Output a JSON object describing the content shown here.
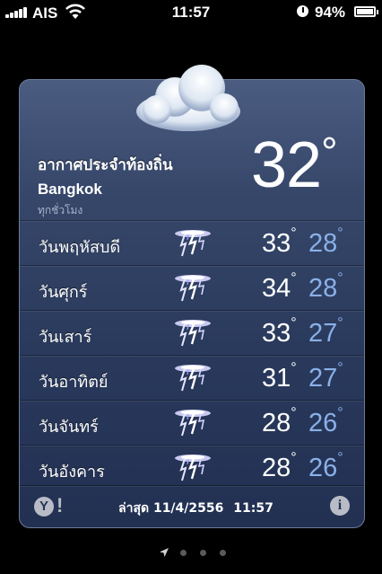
{
  "status_bar": {
    "carrier": "AIS",
    "time": "11:57",
    "battery_percent": "94%",
    "battery_level": 0.94,
    "icons": [
      "signal-icon",
      "wifi-icon",
      "alarm-icon",
      "battery-icon"
    ]
  },
  "weather": {
    "region": "อากาศประจำท้องถิ่น",
    "city": "Bangkok",
    "update_frequency": "ทุกชั่วโมง",
    "current_temp": "32",
    "degree_symbol": "°",
    "condition_icon": "cloud-icon",
    "forecast": [
      {
        "day": "วันพฤหัสบดี",
        "high": "33",
        "low": "28",
        "icon": "thunderstorm-icon"
      },
      {
        "day": "วันศุกร์",
        "high": "34",
        "low": "28",
        "icon": "thunderstorm-icon"
      },
      {
        "day": "วันเสาร์",
        "high": "33",
        "low": "27",
        "icon": "thunderstorm-icon"
      },
      {
        "day": "วันอาทิตย์",
        "high": "31",
        "low": "27",
        "icon": "thunderstorm-icon"
      },
      {
        "day": "วันจันทร์",
        "high": "28",
        "low": "26",
        "icon": "thunderstorm-icon"
      },
      {
        "day": "วันอังคาร",
        "high": "28",
        "low": "26",
        "icon": "thunderstorm-icon"
      }
    ]
  },
  "footer": {
    "yahoo_logo": "Y",
    "yahoo_bang": "!",
    "last_updated_label": "ล่าสุด",
    "last_updated_date": "11/4/2556",
    "last_updated_time": "11:57",
    "info_label": "i"
  },
  "colors": {
    "card_top": "#4a5c80",
    "card_bottom": "#223052",
    "low_temp": "#8ab0e8"
  }
}
